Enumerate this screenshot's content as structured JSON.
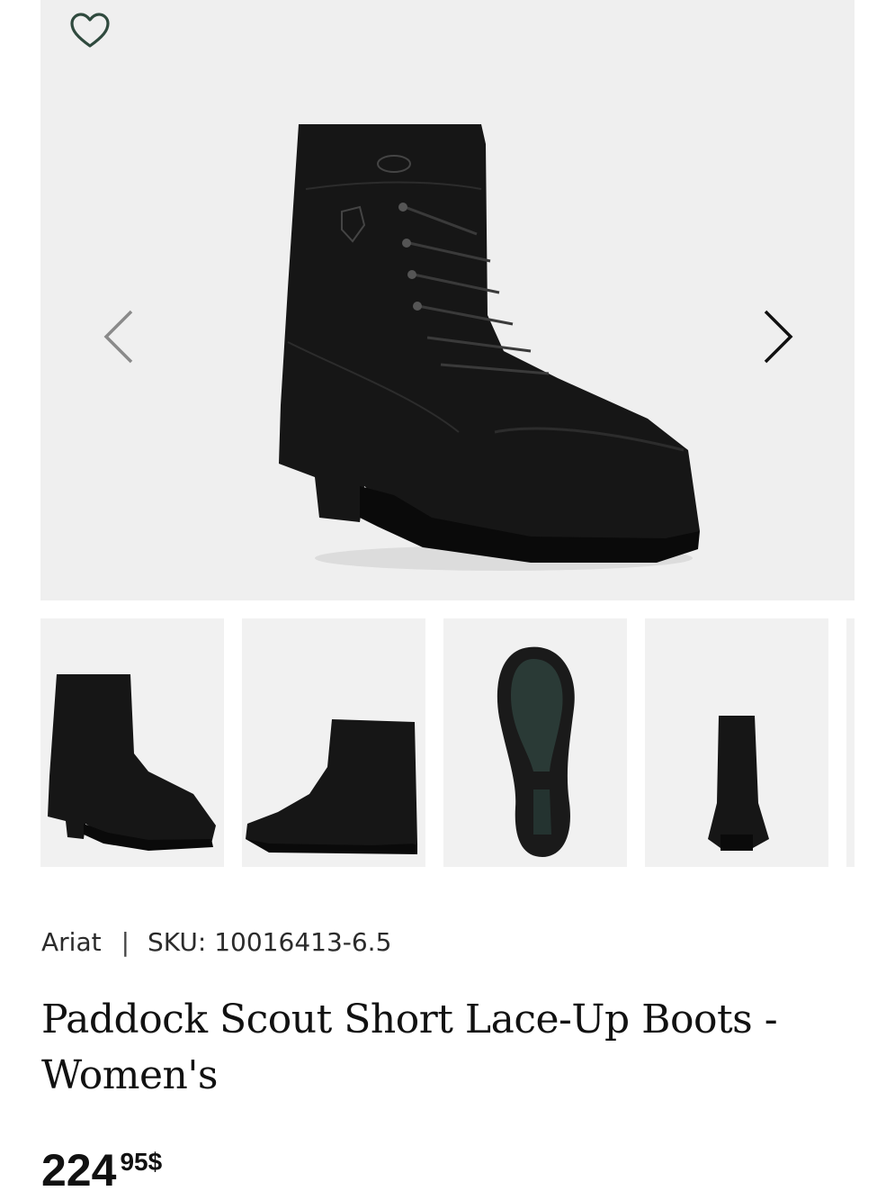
{
  "gallery": {
    "favorite_icon": "heart-outline-icon",
    "prev_icon": "chevron-left-icon",
    "next_icon": "chevron-right-icon",
    "thumbnails": [
      "boot-front-angle",
      "boot-side",
      "boot-sole",
      "boot-back"
    ]
  },
  "product": {
    "brand": "Ariat",
    "separator": "|",
    "sku": "SKU: 10016413-6.5",
    "title": "Paddock Scout Short Lace-Up Boots - Women's",
    "price_int": "224",
    "price_dec": "95$"
  },
  "colors": {
    "accent": "#2f4a3e",
    "image_bg": "#efefef",
    "text": "#111111"
  }
}
